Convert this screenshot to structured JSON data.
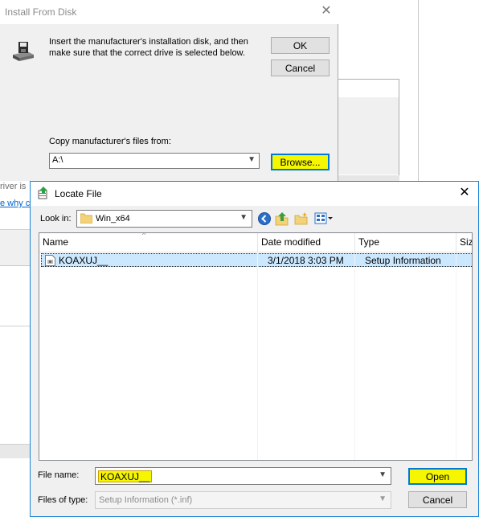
{
  "background": {
    "partial_text_1": "river is",
    "partial_link": "e why c"
  },
  "install_from_disk": {
    "title": "Install From Disk",
    "message": "Insert the manufacturer's installation disk, and then make sure that the correct drive is selected below.",
    "ok_label": "OK",
    "cancel_label": "Cancel",
    "copy_label": "Copy manufacturer's files from:",
    "path_value": "A:\\",
    "browse_label": "Browse..."
  },
  "locate_file": {
    "title": "Locate File",
    "look_in_label": "Look in:",
    "look_in_value": "Win_x64",
    "columns": [
      "Name",
      "Date modified",
      "Type",
      "Size"
    ],
    "files": [
      {
        "name": "KOAXUJ__",
        "date_modified": "3/1/2018 3:03 PM",
        "type": "Setup Information"
      }
    ],
    "file_name_label": "File name:",
    "file_name_value": "KOAXUJ__",
    "files_of_type_label": "Files of type:",
    "files_of_type_value": "Setup Information (*.inf)",
    "open_label": "Open",
    "cancel_label": "Cancel"
  },
  "colors": {
    "highlight": "#f6f600",
    "selection": "#cce8ff",
    "accent": "#0078d7",
    "dialog_bg": "#f0f0f0"
  }
}
